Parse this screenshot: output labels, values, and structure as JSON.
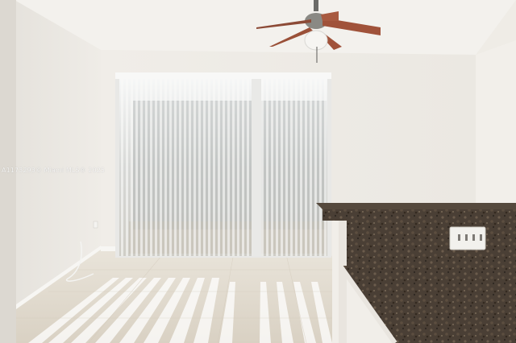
{
  "photo": {
    "watermark": "A1173293© Miami MLS® 2025",
    "colors": {
      "wall": "#eeebe5",
      "ceiling": "#f4f2ee",
      "floor": "#e6dfd2",
      "granite": "#4a3f35",
      "fan_blade": "#a0523a"
    },
    "icons": [
      "ceiling-fan-icon",
      "outlet-icon"
    ]
  }
}
